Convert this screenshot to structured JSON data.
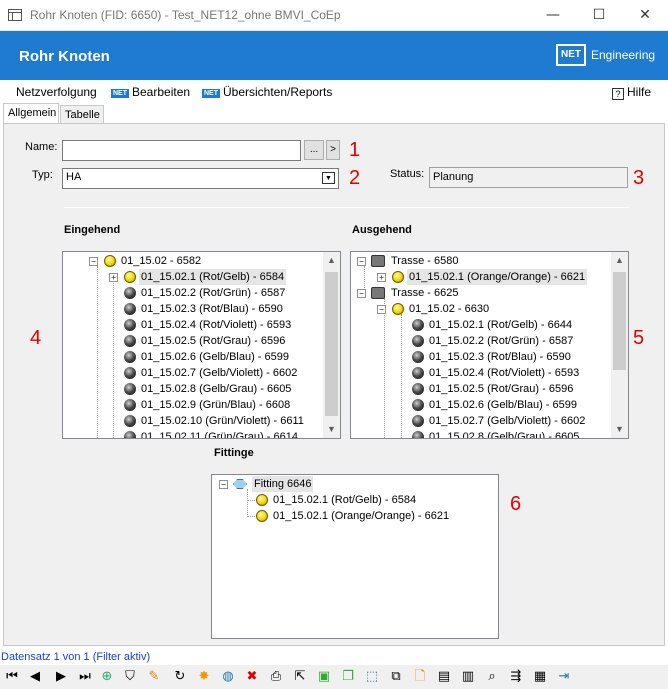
{
  "window": {
    "title": "Rohr Knoten (FID: 6650) - Test_NET12_ohne BMVI_CoEp",
    "minimize": "—",
    "maximize": "☐",
    "close": "✕"
  },
  "banner": {
    "title": "Rohr Knoten",
    "logo_box": "NET",
    "logo_text": "Engineering"
  },
  "menu": {
    "items": [
      "Netzverfolgung",
      "Bearbeiten",
      "Übersichten/Reports"
    ],
    "badge": "NET",
    "help": "Hilfe"
  },
  "tabs": [
    "Allgemein",
    "Tabelle"
  ],
  "form": {
    "name_label": "Name:",
    "name_value": "",
    "name_browse": "...",
    "name_go": ">",
    "typ_label": "Typ:",
    "typ_value": "HA",
    "status_label": "Status:",
    "status_value": "Planung"
  },
  "annotations": [
    "1",
    "2",
    "3",
    "4",
    "5",
    "6"
  ],
  "eingehend": {
    "title": "Eingehend",
    "root": "01_15.02 - 6582",
    "items": [
      "01_15.02.1 (Rot/Gelb) - 6584",
      "01_15.02.2 (Rot/Grün) - 6587",
      "01_15.02.3 (Rot/Blau) - 6590",
      "01_15.02.4 (Rot/Violett) - 6593",
      "01_15.02.5 (Rot/Grau) - 6596",
      "01_15.02.6 (Gelb/Blau) - 6599",
      "01_15.02.7 (Gelb/Violett) - 6602",
      "01_15.02.8 (Gelb/Grau) - 6605",
      "01_15.02.9 (Grün/Blau) - 6608",
      "01_15.02.10 (Grün/Violett) - 6611",
      "01_15.02.11 (Grün/Grau) - 6614"
    ]
  },
  "ausgehend": {
    "title": "Ausgehend",
    "trasse1": "Trasse - 6580",
    "trasse1_child": "01_15.02.1 (Orange/Orange) - 6621",
    "trasse2": "Trasse - 6625",
    "group": "01_15.02 - 6630",
    "items": [
      "01_15.02.1 (Rot/Gelb) - 6644",
      "01_15.02.2 (Rot/Grün) - 6587",
      "01_15.02.3 (Rot/Blau) - 6590",
      "01_15.02.4 (Rot/Violett) - 6593",
      "01_15.02.5 (Rot/Grau) - 6596",
      "01_15.02.6 (Gelb/Blau) - 6599",
      "01_15.02.7 (Gelb/Violett) - 6602",
      "01_15.02.8 (Gelb/Grau) - 6605"
    ]
  },
  "fittinge": {
    "title": "Fittinge",
    "root": "Fitting 6646",
    "items": [
      "01_15.02.1 (Rot/Gelb) - 6584",
      "01_15.02.1 (Orange/Orange) - 6621"
    ]
  },
  "statusline": "Datensatz 1 von 1 (Filter aktiv)",
  "toolbar_icons": [
    "first-record-icon",
    "previous-record-icon",
    "next-record-icon",
    "last-record-icon",
    "add-filter-icon",
    "filter-icon",
    "edit-icon",
    "refresh-icon",
    "new-icon",
    "globe-refresh-icon",
    "delete-icon",
    "print-icon",
    "select-icon",
    "cube-icon",
    "copy-geometry-icon",
    "select-area-icon",
    "duplicate-icon",
    "new-document-icon",
    "image-icon",
    "text-file-icon",
    "zoom-to-icon",
    "merge-icon",
    "table-icon",
    "exit-icon"
  ]
}
